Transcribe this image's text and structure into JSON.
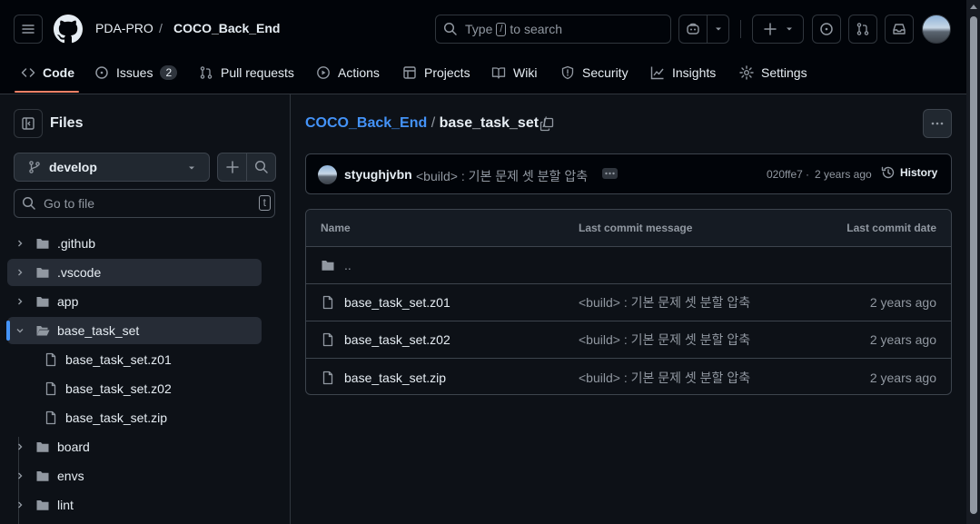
{
  "header": {
    "owner": "PDA-PRO",
    "separator": "/",
    "repo": "COCO_Back_End",
    "search_prefix": "Type",
    "search_key": "/",
    "search_suffix": "to search"
  },
  "tabs": [
    {
      "label": "Code",
      "icon": "code-icon"
    },
    {
      "label": "Issues",
      "icon": "issue-icon",
      "count": "2"
    },
    {
      "label": "Pull requests",
      "icon": "pull-request-icon"
    },
    {
      "label": "Actions",
      "icon": "play-icon"
    },
    {
      "label": "Projects",
      "icon": "table-icon"
    },
    {
      "label": "Wiki",
      "icon": "book-icon"
    },
    {
      "label": "Security",
      "icon": "shield-icon"
    },
    {
      "label": "Insights",
      "icon": "graph-icon"
    },
    {
      "label": "Settings",
      "icon": "gear-icon"
    }
  ],
  "sidebar": {
    "title": "Files",
    "branch": "develop",
    "go_to_file_placeholder": "Go to file",
    "go_to_file_key": "t",
    "tree": [
      {
        "name": ".github",
        "type": "folder"
      },
      {
        "name": ".vscode",
        "type": "folder"
      },
      {
        "name": "app",
        "type": "folder"
      },
      {
        "name": "base_task_set",
        "type": "folder-open"
      },
      {
        "name": "base_task_set.z01",
        "type": "file"
      },
      {
        "name": "base_task_set.z02",
        "type": "file"
      },
      {
        "name": "base_task_set.zip",
        "type": "file"
      },
      {
        "name": "board",
        "type": "folder"
      },
      {
        "name": "envs",
        "type": "folder"
      },
      {
        "name": "lint",
        "type": "folder"
      }
    ]
  },
  "main": {
    "breadcrumb_repo": "COCO_Back_End",
    "breadcrumb_sep": "/",
    "breadcrumb_folder": "base_task_set",
    "breadcrumb_trail": "/",
    "commit": {
      "author": "styughjvbn",
      "message": "<build> : 기본 문제 셋 분할 압축",
      "sha": "020ffe7",
      "dot": "·",
      "time": "2 years ago",
      "history_label": "History"
    },
    "table": {
      "headers": [
        "Name",
        "Last commit message",
        "Last commit date"
      ],
      "parent_row": "..",
      "rows": [
        {
          "name": "base_task_set.z01",
          "message": "<build> : 기본 문제 셋 분할 압축",
          "date": "2 years ago"
        },
        {
          "name": "base_task_set.z02",
          "message": "<build> : 기본 문제 셋 분할 압축",
          "date": "2 years ago"
        },
        {
          "name": "base_task_set.zip",
          "message": "<build> : 기본 문제 셋 분할 압축",
          "date": "2 years ago"
        }
      ]
    }
  },
  "colors": {
    "background": "#0d1117",
    "header": "#010409",
    "border": "#30363d",
    "link": "#4493f8",
    "muted": "#9198a1",
    "tab_underline": "#f78166",
    "selection_bar": "#4493f8"
  }
}
